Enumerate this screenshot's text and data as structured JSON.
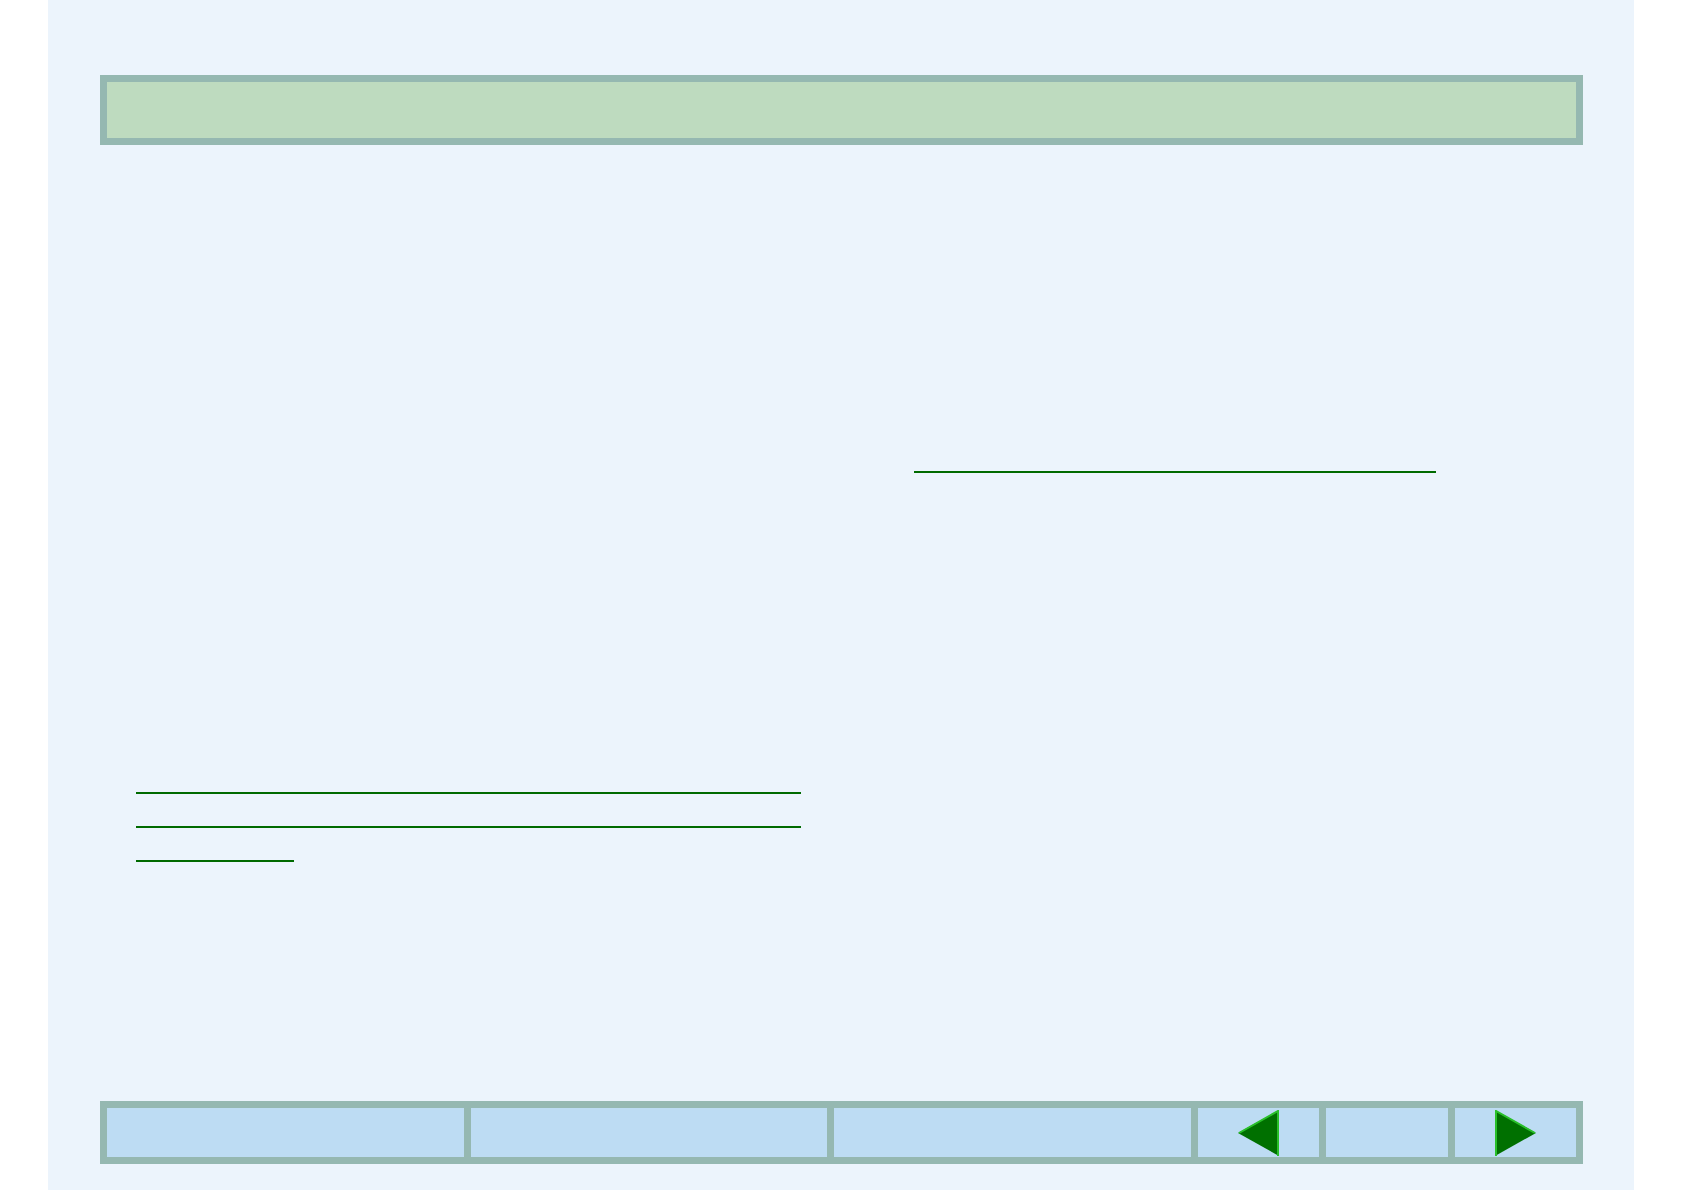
{
  "header_bar": {
    "kind": "banner"
  },
  "columns": [
    {
      "underlines": [
        {
          "kind": "full"
        },
        {
          "kind": "full"
        },
        {
          "kind": "partial"
        }
      ]
    },
    {
      "underlines": [
        {
          "kind": "full"
        }
      ]
    }
  ],
  "nav_bar": {
    "cells": [
      {
        "kind": "blank"
      },
      {
        "kind": "blank"
      },
      {
        "kind": "blank"
      },
      {
        "kind": "previous"
      },
      {
        "kind": "blank"
      },
      {
        "kind": "next"
      }
    ]
  }
}
